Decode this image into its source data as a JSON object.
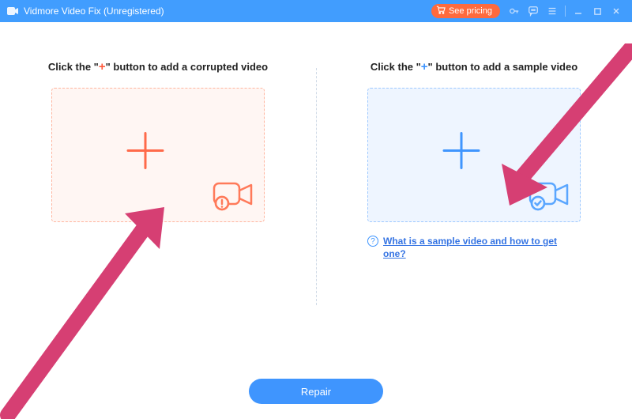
{
  "titlebar": {
    "title": "Vidmore Video Fix (Unregistered)",
    "pricing_label": "See pricing"
  },
  "left_panel": {
    "instr_pre": "Click the \"",
    "instr_plus": "+",
    "instr_post": "\" button to add a corrupted video"
  },
  "right_panel": {
    "instr_pre": "Click the \"",
    "instr_plus": "+",
    "instr_post": "\" button to add a sample video",
    "help_link": "What is a sample video and how to get one?"
  },
  "footer": {
    "repair_label": "Repair"
  },
  "colors": {
    "accent_blue": "#3f95fe",
    "accent_orange": "#ff5a3c",
    "titlebar_bg": "#419dfe",
    "pricing_bg": "#ff6a3d",
    "annotation_arrow": "#d63f73"
  }
}
